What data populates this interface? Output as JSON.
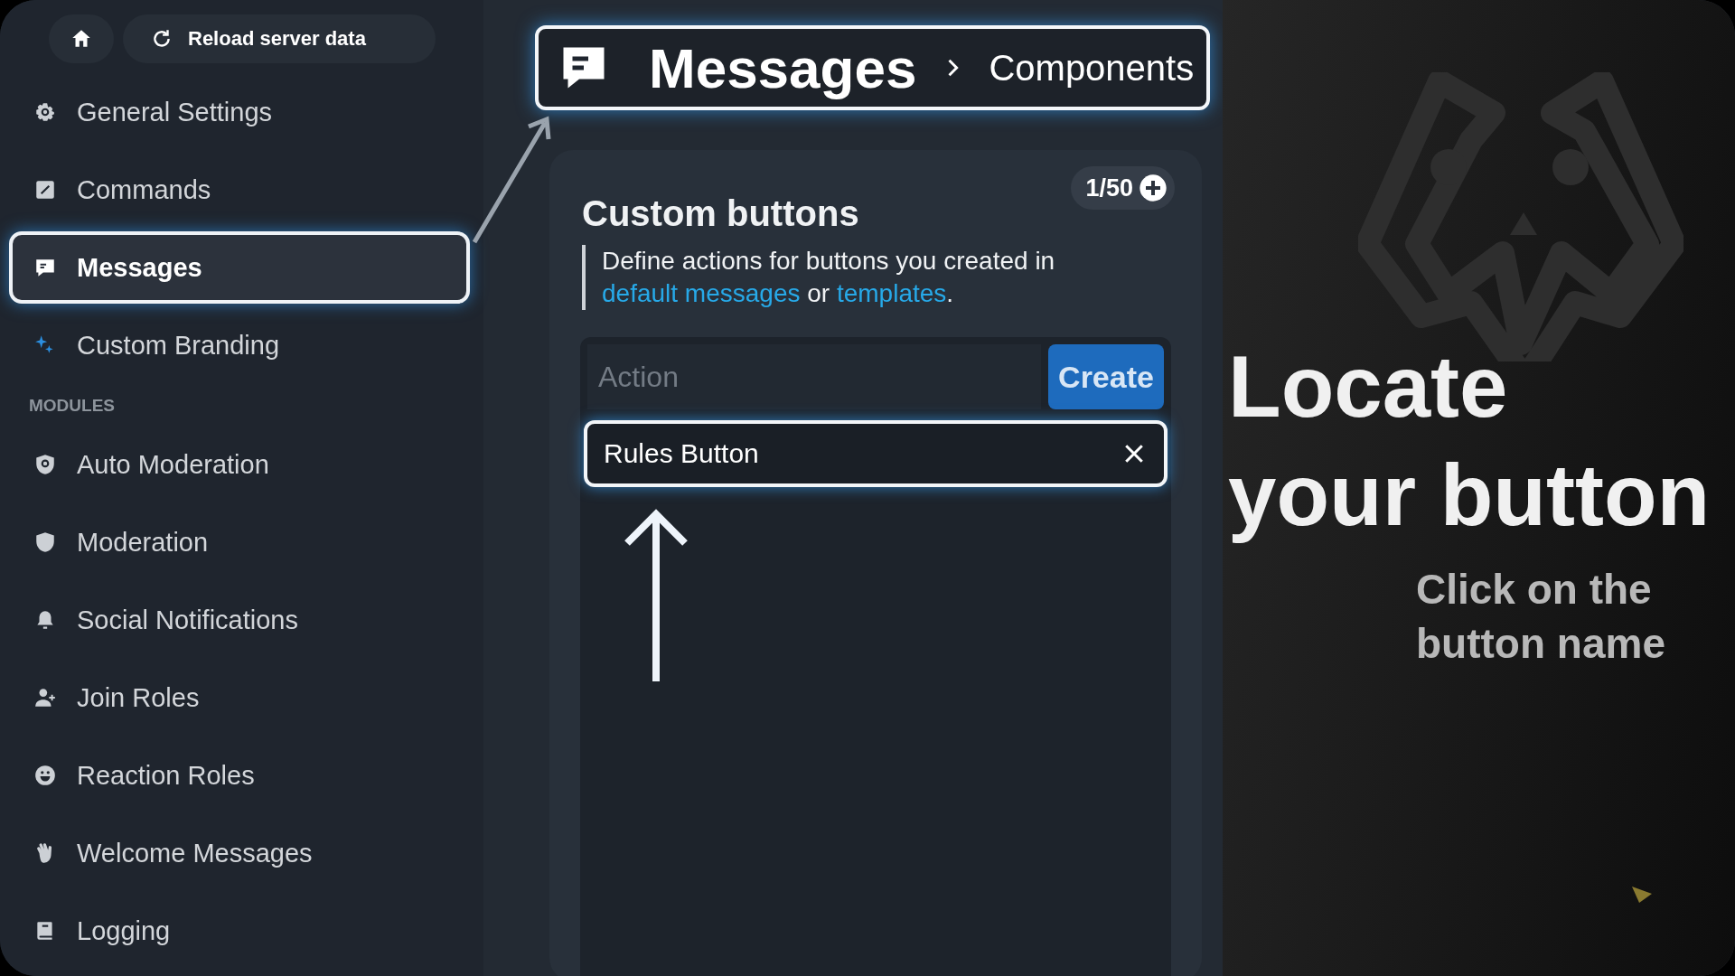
{
  "top_bar": {
    "reload_button": "Reload server data"
  },
  "sidebar": {
    "items": [
      {
        "label": "General Settings",
        "selected": false
      },
      {
        "label": "Commands",
        "selected": false
      },
      {
        "label": "Messages",
        "selected": true
      },
      {
        "label": "Custom Branding",
        "selected": false
      }
    ],
    "section_label": "MODULES",
    "module_items": [
      {
        "label": "Auto Moderation",
        "selected": false
      },
      {
        "label": "Moderation",
        "selected": false
      },
      {
        "label": "Social Notifications",
        "selected": false
      },
      {
        "label": "Join Roles",
        "selected": false
      },
      {
        "label": "Reaction Roles",
        "selected": false
      },
      {
        "label": "Welcome Messages",
        "selected": false
      },
      {
        "label": "Logging",
        "selected": false
      }
    ]
  },
  "header": {
    "title": "Messages",
    "breadcrumb": "Components"
  },
  "card": {
    "title": "Custom buttons",
    "counter": "1/50",
    "description": {
      "text": "Define actions for buttons you created in",
      "link_1": "default messages",
      "conjunction": "or",
      "link_2": "templates",
      "end": "."
    },
    "action_field": {
      "placeholder": "Action"
    },
    "create_button": "Create",
    "buttons": [
      {
        "name": "Rules Button",
        "highlighted": true
      }
    ]
  },
  "overlay": {
    "heading": "Locate\nyour button",
    "subheading": "Click on the\nbutton name"
  }
}
